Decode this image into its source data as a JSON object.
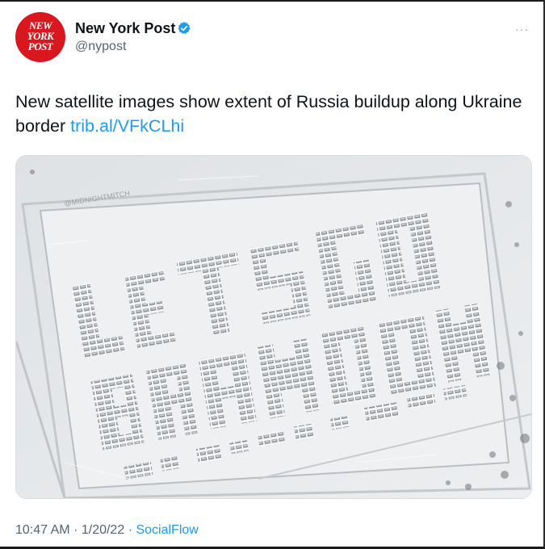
{
  "account": {
    "logo_lines": [
      "NEW",
      "YORK",
      "POST"
    ],
    "display_name": "New York Post",
    "handle": "@nypost",
    "verified": true,
    "more_icon": "ellipsis-icon"
  },
  "tweet": {
    "text": "New satellite images show extent of Russia buildup along Ukraine border",
    "link": "trib.al/VFkCLhi"
  },
  "media": {
    "watermark": "@MIDNIGHTMITCH",
    "formation_line_1": "LETS GO",
    "formation_line_2": "BRANDON"
  },
  "meta": {
    "time": "10:47 AM",
    "date": "1/20/22",
    "source": "SocialFlow",
    "separator": "·"
  },
  "colors": {
    "brand_red": "#d8171e",
    "link_blue": "#1d9bf0",
    "verified_blue": "#1d9bf0",
    "muted": "#536471"
  }
}
